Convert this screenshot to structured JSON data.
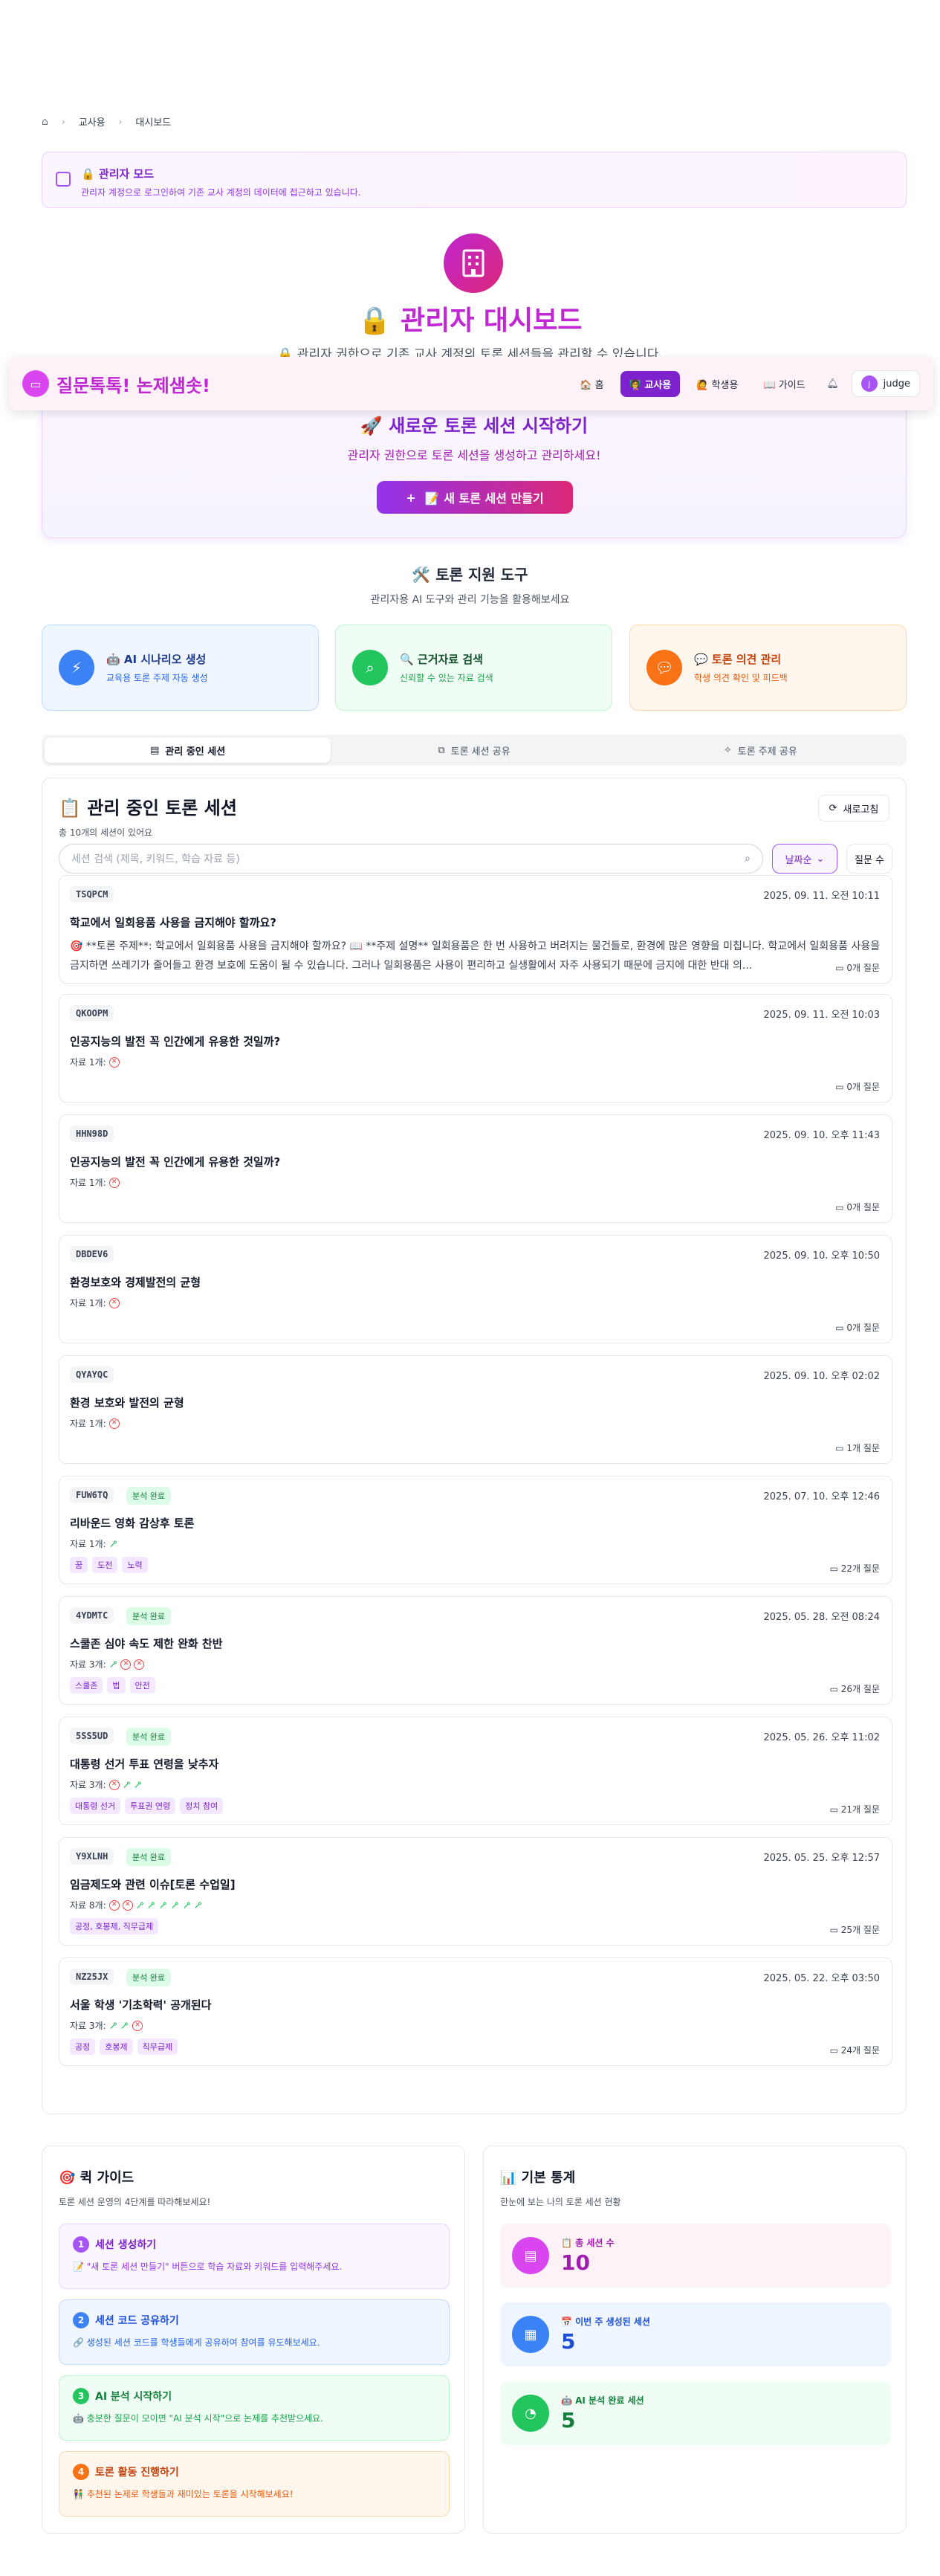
{
  "breadcrumb": {
    "home_icon": "home-icon",
    "items": [
      "교사용",
      "대시보드"
    ]
  },
  "admin_mode": {
    "title": "🔒 관리자 모드",
    "desc": "관리자 계정으로 로그인하여 기존 교사 계정의 데이터에 접근하고 있습니다."
  },
  "hero": {
    "title": "🔒 관리자 대시보드",
    "subtitle": "🔒 관리자 권한으로 기존 교사 계정의 토론 세션들을 관리할 수 있습니다."
  },
  "navbar": {
    "brand": "질문톡톡! 논제샘솟!",
    "links": [
      "🏠 홈",
      "👩‍🏫 교사용",
      "🙋 학생용",
      "📖 가이드"
    ],
    "user": "judge",
    "avatar_letter": "j"
  },
  "new_session": {
    "title": "🚀 새로운 토론 세션 시작하기",
    "subtitle": "관리자 권한으로 토론 세션을 생성하고 관리하세요!",
    "button": "📝 새 토론 세션 만들기",
    "button_plus": "+"
  },
  "tools": {
    "title": "🛠️ 토론 지원 도구",
    "subtitle": "관리자용 AI 도구와 관리 기능을 활용해보세요",
    "items": [
      {
        "title": "🤖 AI 시나리오 생성",
        "desc": "교육용 토론 주제 자동 생성"
      },
      {
        "title": "🔍 근거자료 검색",
        "desc": "신뢰할 수 있는 자료 검색"
      },
      {
        "title": "💬 토론 의견 관리",
        "desc": "학생 의견 확인 및 피드백"
      }
    ]
  },
  "tabs": [
    "관리 중인 세션",
    "토론 세션 공유",
    "토론 주제 공유"
  ],
  "sessions_panel": {
    "title": "📋 관리 중인 토론 세션",
    "count": "총 10개의 세션이 있어요",
    "refresh": "새로고침",
    "search_placeholder": "세션 검색 (제목, 키워드, 학습 자료 등)",
    "sort": "날짜순",
    "sort2": "질문 수"
  },
  "sessions": [
    {
      "code": "TSQPCM",
      "date": "2025. 09. 11. 오전 10:11",
      "title": "학교에서 일회용품 사용을 금지해야 할까요?",
      "desc": "🎯 **토론 주제**: 학교에서 일회용품 사용을 금지해야 할까요? 📖 **주제 설명** 일회용품은 한 번 사용하고 버려지는 물건들로, 환경에 많은 영향을 미칩니다. 학교에서 일회용품 사용을 금지하면 쓰레기가 줄어들고 환경 보호에 도움이 될 수 있습니다. 그러나 일회용품은 사용이 편리하고 실생활에서 자주 사용되기 때문에 금지에 대한 반대 의...",
      "questions": "0개 질문"
    },
    {
      "code": "QKOOPM",
      "date": "2025. 09. 11. 오전 10:03",
      "title": "인공지능의 발전 꼭 인간에게 유용한 것일까?",
      "materials_label": "자료 1개:",
      "questions": "0개 질문"
    },
    {
      "code": "HHN98D",
      "date": "2025. 09. 10. 오후 11:43",
      "title": "인공지능의 발전 꼭 인간에게 유용한 것일까?",
      "materials_label": "자료 1개:",
      "questions": "0개 질문"
    },
    {
      "code": "DBDEV6",
      "date": "2025. 09. 10. 오후 10:50",
      "title": "환경보호와 경제발전의 균형",
      "materials_label": "자료 1개:",
      "questions": "0개 질문"
    },
    {
      "code": "QYAYQC",
      "date": "2025. 09. 10. 오후 02:02",
      "title": "환경 보호와 발전의 균형",
      "materials_label": "자료 1개:",
      "questions": "1개 질문"
    },
    {
      "code": "FUW6TQ",
      "badge": "분석 완료",
      "date": "2025. 07. 10. 오후 12:46",
      "title": "리바운드 영화 감상후 토론",
      "materials_label": "자료 1개:",
      "tags": [
        "꿈",
        "도전",
        "노력"
      ],
      "questions": "22개 질문"
    },
    {
      "code": "4YDMTC",
      "badge": "분석 완료",
      "date": "2025. 05. 28. 오전 08:24",
      "title": "스쿨존 심야 속도 제한 완화 찬반",
      "materials_label": "자료 3개:",
      "tags": [
        "스쿨존",
        "법",
        "안전"
      ],
      "questions": "26개 질문"
    },
    {
      "code": "5SS5UD",
      "badge": "분석 완료",
      "date": "2025. 05. 26. 오후 11:02",
      "title": "대통령 선거 투표 연령을 낮추자",
      "materials_label": "자료 3개:",
      "tags": [
        "대통령 선거",
        "투표권 연령",
        "정치 참여"
      ],
      "questions": "21개 질문"
    },
    {
      "code": "Y9XLNH",
      "badge": "분석 완료",
      "date": "2025. 05. 25. 오후 12:57",
      "title": "임금제도와 관련 이슈[토론 수업일]",
      "materials_label": "자료 8개:",
      "tags": [
        "공정, 호봉제, 직무급제"
      ],
      "questions": "25개 질문"
    },
    {
      "code": "NZ25JX",
      "badge": "분석 완료",
      "date": "2025. 05. 22. 오후 03:50",
      "title": "서울 학생 '기초학력' 공개된다",
      "materials_label": "자료 3개:",
      "tags": [
        "공정",
        "호봉제",
        "직무급제"
      ],
      "questions": "24개 질문"
    }
  ],
  "quick_guide": {
    "title": "🎯 퀵 가이드",
    "subtitle": "토론 세션 운영의 4단계를 따라해보세요!",
    "steps": [
      {
        "num": "1",
        "title": "세션 생성하기",
        "desc": "📝 \"새 토론 세션 만들기\" 버튼으로 학습 자료와 키워드를 입력해주세요."
      },
      {
        "num": "2",
        "title": "세션 코드 공유하기",
        "desc": "🔗 생성된 세션 코드를 학생들에게 공유하여 참여를 유도해보세요."
      },
      {
        "num": "3",
        "title": "AI 분석 시작하기",
        "desc": "🤖 충분한 질문이 모이면 \"AI 분석 시작\"으로 논제를 추천받으세요."
      },
      {
        "num": "4",
        "title": "토론 활동 진행하기",
        "desc": "👫 추천된 논제로 학생들과 재미있는 토론을 시작해보세요!"
      }
    ]
  },
  "stats": {
    "title": "📊 기본 통계",
    "subtitle": "한눈에 보는 나의 토론 세션 현황",
    "items": [
      {
        "label": "📋 총 세션 수",
        "value": "10"
      },
      {
        "label": "📅 이번 주 생성된 세션",
        "value": "5"
      },
      {
        "label": "🤖 AI 분석 완료 세션",
        "value": "5"
      }
    ]
  }
}
